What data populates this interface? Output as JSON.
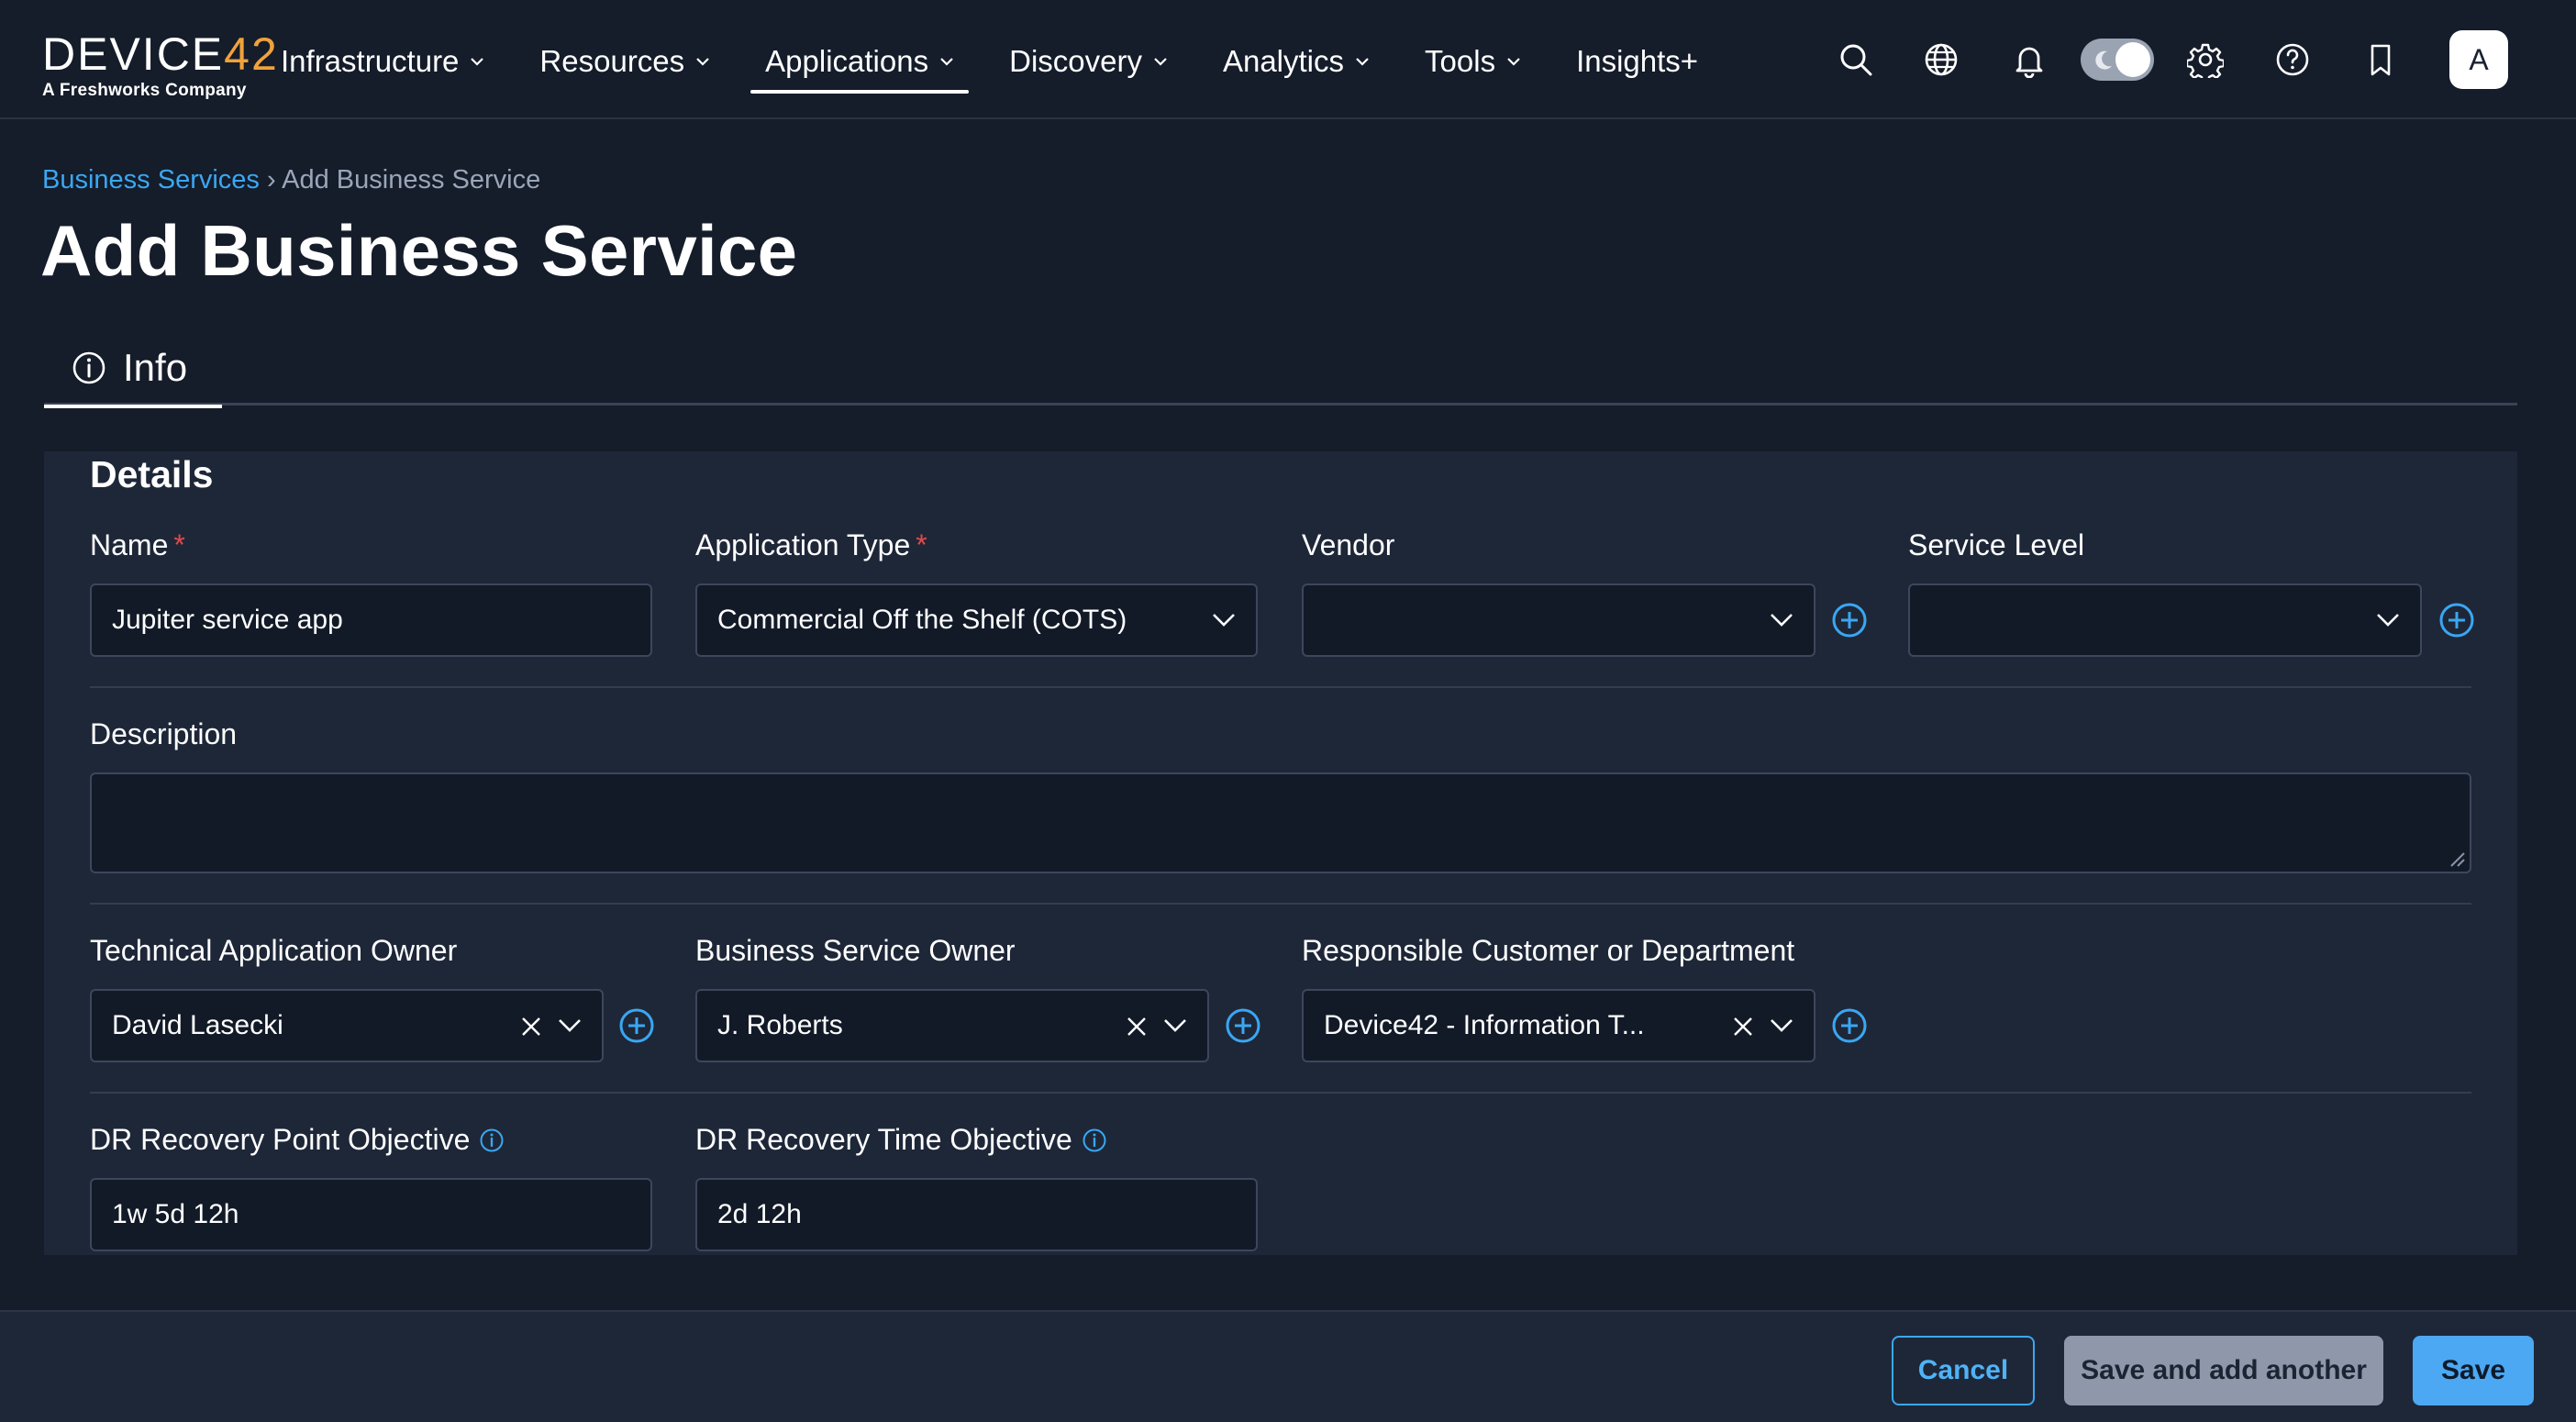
{
  "logo": {
    "brand_prefix": "DEVICE",
    "brand_suffix": "42",
    "tagline": "A Freshworks Company"
  },
  "nav": {
    "items": [
      {
        "label": "Infrastructure",
        "has_dropdown": true
      },
      {
        "label": "Resources",
        "has_dropdown": true
      },
      {
        "label": "Applications",
        "has_dropdown": true,
        "active": true
      },
      {
        "label": "Discovery",
        "has_dropdown": true
      },
      {
        "label": "Analytics",
        "has_dropdown": true
      },
      {
        "label": "Tools",
        "has_dropdown": true
      },
      {
        "label": "Insights+",
        "has_dropdown": false
      }
    ],
    "right_icons": [
      "search-icon",
      "globe-icon",
      "bell-icon",
      "theme-toggle",
      "gear-icon",
      "help-icon",
      "bookmark-icon"
    ],
    "avatar_initial": "A"
  },
  "breadcrumb": {
    "parent": "Business Services",
    "separator": "›",
    "current": "Add Business Service"
  },
  "page_title": "Add Business Service",
  "tabs": [
    {
      "label": "Info",
      "icon": "info-icon",
      "active": true
    }
  ],
  "details": {
    "title": "Details",
    "name": {
      "label": "Name",
      "required": true,
      "value": "Jupiter service app"
    },
    "application_type": {
      "label": "Application Type",
      "required": true,
      "value": "Commercial Off the Shelf (COTS)"
    },
    "vendor": {
      "label": "Vendor",
      "value": ""
    },
    "service_level": {
      "label": "Service Level",
      "value": ""
    },
    "description": {
      "label": "Description",
      "value": ""
    },
    "technical_owner": {
      "label": "Technical Application Owner",
      "value": "David Lasecki"
    },
    "business_owner": {
      "label": "Business Service Owner",
      "value": "J. Roberts"
    },
    "responsible_customer": {
      "label": "Responsible Customer or Department",
      "value": "Device42 - Information T..."
    },
    "dr_rpo": {
      "label": "DR Recovery Point Objective",
      "value": "1w 5d 12h"
    },
    "dr_rto": {
      "label": "DR Recovery Time Objective",
      "value": "2d 12h"
    },
    "required_marker": "*"
  },
  "footer": {
    "cancel_label": "Cancel",
    "save_another_label": "Save and add another",
    "save_label": "Save"
  },
  "colors": {
    "background": "#151c2a",
    "panel": "#1e2738",
    "accent": "#3aa7f2",
    "required": "#e04a4a",
    "save_button": "#4ca8f2"
  }
}
